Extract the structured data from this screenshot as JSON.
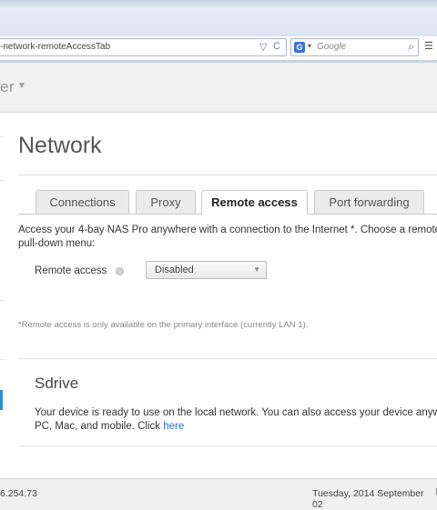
{
  "browser": {
    "url": "-network-remoteAccessTab",
    "search_engine_icon": "G",
    "search_placeholder": "Google",
    "icons": [
      "dropdown-icon",
      "reload-icon",
      "search-go-icon",
      "menu-icon"
    ]
  },
  "app": {
    "title_fragment": "er"
  },
  "page": {
    "title": "Network",
    "tabs": [
      {
        "label": "Connections"
      },
      {
        "label": "Proxy"
      },
      {
        "label": "Remote access",
        "active": true
      },
      {
        "label": "Port forwarding"
      }
    ],
    "description_line1": "Access your 4-bay NAS Pro anywhere with a connection to the Internet *. Choose a remote a",
    "description_line2": "pull-down menu:",
    "remote_access_label": "Remote access",
    "remote_access_value": "Disabled",
    "footnote": "*Remote access is only available on the primary interface (currently LAN 1).",
    "sdrive": {
      "title": "Sdrive",
      "body_line1": "Your device is ready to use on the local network. You can also access your device anywh",
      "body_line2": "PC, Mac, and mobile. Click",
      "link": "here"
    }
  },
  "status": {
    "ip_fragment": "6.254.73",
    "date": "Tuesday, 2014 September 02",
    "sep": "I"
  },
  "colors": {
    "accent": "#2a8fd6",
    "link": "#1e73c9"
  }
}
